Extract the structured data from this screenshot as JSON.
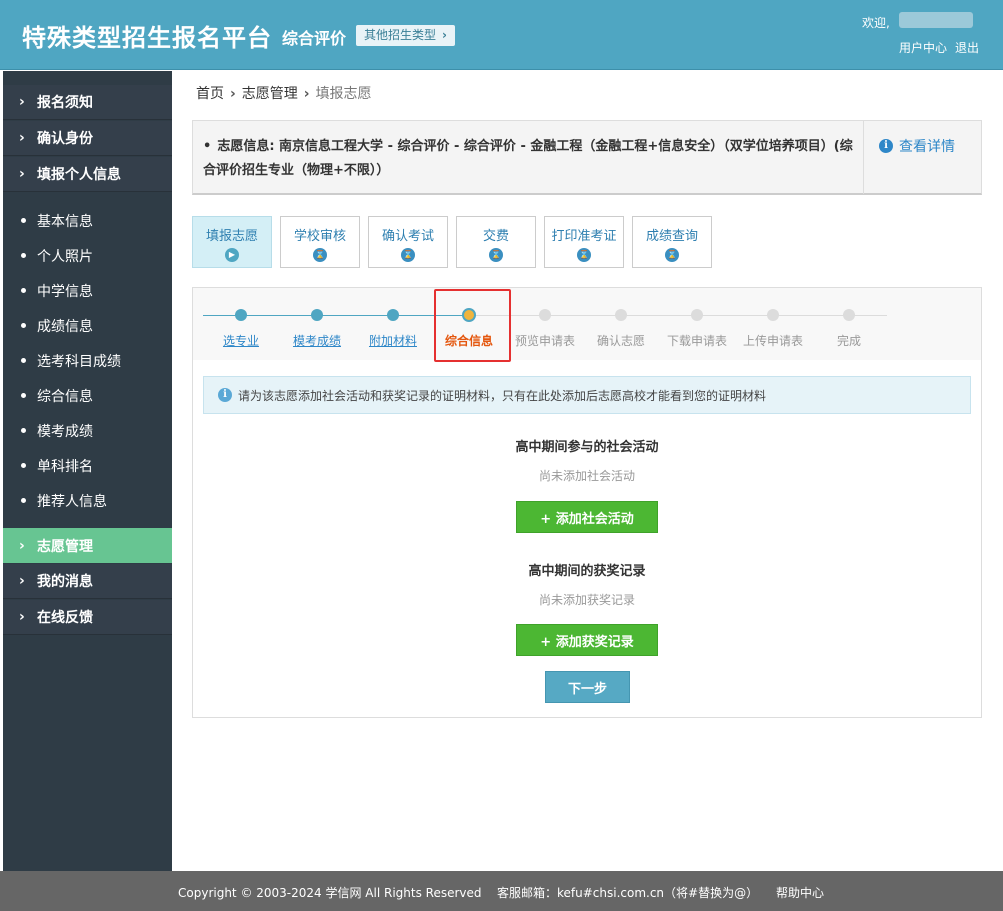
{
  "header": {
    "title": "特殊类型招生报名平台",
    "mode": "综合评价",
    "other_type": "其他招生类型",
    "welcome": "欢迎,",
    "user_center": "用户中心",
    "logout": "退出"
  },
  "sidebar": {
    "items": [
      {
        "label": "报名须知"
      },
      {
        "label": "确认身份"
      },
      {
        "label": "填报个人信息"
      }
    ],
    "sub_items": [
      {
        "label": "基本信息"
      },
      {
        "label": "个人照片"
      },
      {
        "label": "中学信息"
      },
      {
        "label": "成绩信息"
      },
      {
        "label": "选考科目成绩"
      },
      {
        "label": "综合信息"
      },
      {
        "label": "模考成绩"
      },
      {
        "label": "单科排名"
      },
      {
        "label": "推荐人信息"
      }
    ],
    "lower_items": [
      {
        "label": "志愿管理"
      },
      {
        "label": "我的消息"
      },
      {
        "label": "在线反馈"
      }
    ]
  },
  "breadcrumb": {
    "home": "首页",
    "mid": "志愿管理",
    "last": "填报志愿"
  },
  "info": {
    "text": "志愿信息: 南京信息工程大学 - 综合评价 - 综合评价 - 金融工程（金融工程+信息安全）（双学位培养项目）(综合评价招生专业（物理+不限））",
    "detail_link": "查看详情"
  },
  "tabs": [
    {
      "label": "填报志愿"
    },
    {
      "label": "学校审核"
    },
    {
      "label": "确认考试"
    },
    {
      "label": "交费"
    },
    {
      "label": "打印准考证"
    },
    {
      "label": "成绩查询"
    }
  ],
  "steps": [
    {
      "label": "选专业",
      "state": "done"
    },
    {
      "label": "模考成绩",
      "state": "done"
    },
    {
      "label": "附加材料",
      "state": "done"
    },
    {
      "label": "综合信息",
      "state": "current"
    },
    {
      "label": "预览申请表",
      "state": "todo"
    },
    {
      "label": "确认志愿",
      "state": "todo"
    },
    {
      "label": "下载申请表",
      "state": "todo"
    },
    {
      "label": "上传申请表",
      "state": "todo"
    },
    {
      "label": "完成",
      "state": "todo"
    }
  ],
  "notice": "请为该志愿添加社会活动和获奖记录的证明材料，只有在此处添加后志愿高校才能看到您的证明材料",
  "social": {
    "title": "高中期间参与的社会活动",
    "empty": "尚未添加社会活动",
    "button": "+ 添加社会活动"
  },
  "awards": {
    "title": "高中期间的获奖记录",
    "empty": "尚未添加获奖记录",
    "button": "+ 添加获奖记录"
  },
  "next_button": "下一步",
  "footer": {
    "copyright": "Copyright © 2003-2024 学信网 All Rights Reserved",
    "email": "客服邮箱：kefu#chsi.com.cn（将#替换为@）",
    "help": "帮助中心"
  },
  "colors": {
    "header": "#4fa6c2",
    "sidebar": "#2f3c46",
    "sidebar_active": "#67c592",
    "green_button": "#4cb733",
    "current_step": "#e4570f",
    "highlight": "#e53030"
  }
}
